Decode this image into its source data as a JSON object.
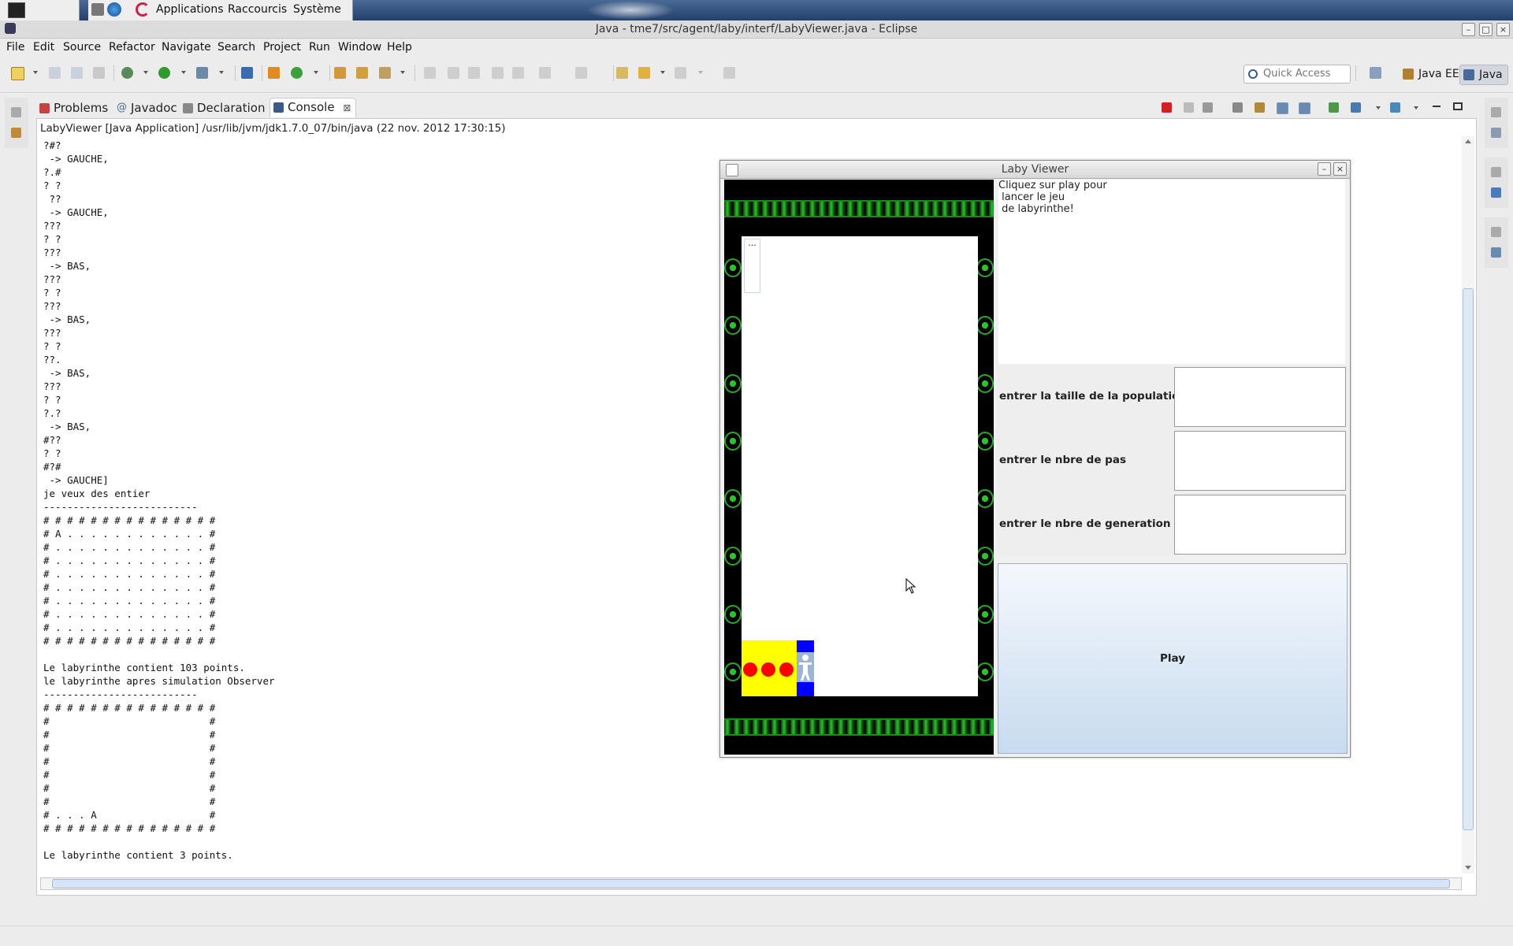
{
  "top_panel": {
    "menus": [
      "Applications",
      "Raccourcis",
      "Système"
    ]
  },
  "window": {
    "title": "Java - tme7/src/agent/laby/interf/LabyViewer.java - Eclipse"
  },
  "menu_bar": [
    "File",
    "Edit",
    "Source",
    "Refactor",
    "Navigate",
    "Search",
    "Project",
    "Run",
    "Window",
    "Help"
  ],
  "toolbar": {
    "quick_access_placeholder": "Quick Access",
    "perspectives": [
      "Java EE",
      "Java"
    ]
  },
  "view_tabs": {
    "problems": "Problems",
    "javadoc": "Javadoc",
    "declaration": "Declaration",
    "console": "Console",
    "console_close": "⊠"
  },
  "console": {
    "process_label": "LabyViewer [Java Application] /usr/lib/jvm/jdk1.7.0_07/bin/java (22 nov. 2012 17:30:15)",
    "lines": [
      "?#?",
      " -> GAUCHE,",
      "?.#",
      "? ?",
      " ??",
      " -> GAUCHE,",
      "???",
      "? ?",
      "???",
      " -> BAS,",
      "???",
      "? ?",
      "???",
      " -> BAS,",
      "???",
      "? ?",
      "??.",
      " -> BAS,",
      "???",
      "? ?",
      "?.?",
      " -> BAS,",
      "#??",
      "? ?",
      "#?#",
      " -> GAUCHE]",
      "je veux des entier",
      "--------------------------",
      "# # # # # # # # # # # # # # #",
      "# A . . . . . . . . . . . . #",
      "# . . . . . . . . . . . . . #",
      "# . . . . . . . . . . . . . #",
      "# . . . . . . . . . . . . . #",
      "# . . . . . . . . . . . . . #",
      "# . . . . . . . . . . . . . #",
      "# . . . . . . . . . . . . . #",
      "# . . . . . . . . . . . . . #",
      "# # # # # # # # # # # # # # #",
      "",
      "Le labyrinthe contient 103 points.",
      "le labyrinthe apres simulation Observer",
      "--------------------------",
      "# # # # # # # # # # # # # # #",
      "#                           #",
      "#                           #",
      "#                           #",
      "#                           #",
      "#                           #",
      "#                           #",
      "#                           #",
      "# . . . A                   #",
      "# # # # # # # # # # # # # # #",
      "",
      "Le labyrinthe contient 3 points."
    ]
  },
  "laby_viewer": {
    "title": "Laby Viewer",
    "small_label": "...",
    "info_text": "Cliquez sur play pour\n lancer le jeu\n de labyrinthe!",
    "fields": {
      "population_label": "entrer la taille de la population",
      "population_value": "",
      "steps_label": "entrer le nbre de pas",
      "steps_value": "",
      "generations_label": "entrer le nbre de generation",
      "generations_value": ""
    },
    "play_label": "Play"
  },
  "colors": {
    "panel_blue": "#23406d",
    "maze_wall_green": "#2fbf2f",
    "maze_background": "#000000",
    "coin_red": "#ff0000",
    "cell_yellow": "#ffff00",
    "agent_blue": "#0000ff"
  }
}
